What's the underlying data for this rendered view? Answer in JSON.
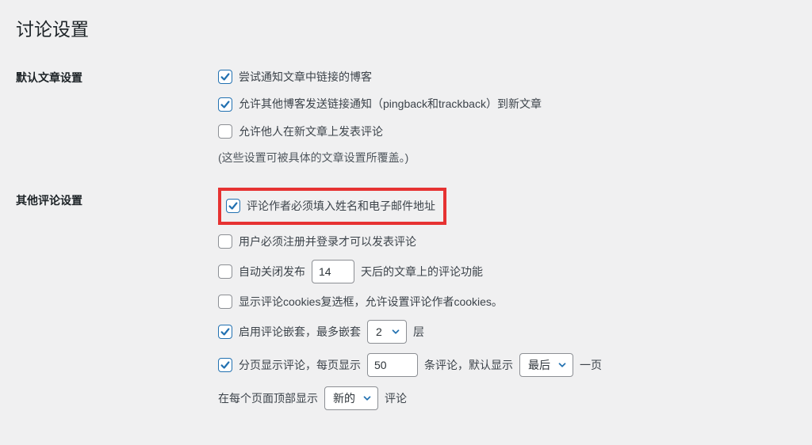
{
  "page_title": "讨论设置",
  "sections": {
    "default_article": {
      "heading": "默认文章设置",
      "items": {
        "notify_links": {
          "label": "尝试通知文章中链接的博客",
          "checked": true
        },
        "allow_pingback": {
          "label": "允许其他博客发送链接通知（pingback和trackback）到新文章",
          "checked": true
        },
        "allow_comments": {
          "label": "允许他人在新文章上发表评论",
          "checked": false
        }
      },
      "note": "(这些设置可被具体的文章设置所覆盖。)"
    },
    "other_comments": {
      "heading": "其他评论设置",
      "require_name_email": {
        "label": "评论作者必须填入姓名和电子邮件地址",
        "checked": true
      },
      "must_register": {
        "label": "用户必须注册并登录才可以发表评论",
        "checked": false
      },
      "auto_close": {
        "checked": false,
        "label_before": "自动关闭发布",
        "days": "14",
        "label_after": "天后的文章上的评论功能"
      },
      "show_cookies": {
        "label": "显示评论cookies复选框，允许设置评论作者cookies。",
        "checked": false
      },
      "nested": {
        "checked": true,
        "label_before": "启用评论嵌套，最多嵌套",
        "levels": "2",
        "label_after": "层"
      },
      "paginate": {
        "checked": true,
        "label_before": "分页显示评论，每页显示",
        "per_page": "50",
        "label_mid": "条评论，默认显示",
        "default_page": "最后",
        "label_after": "一页"
      },
      "order": {
        "label_before": "在每个页面顶部显示",
        "value": "新的",
        "label_after": "评论"
      }
    }
  }
}
